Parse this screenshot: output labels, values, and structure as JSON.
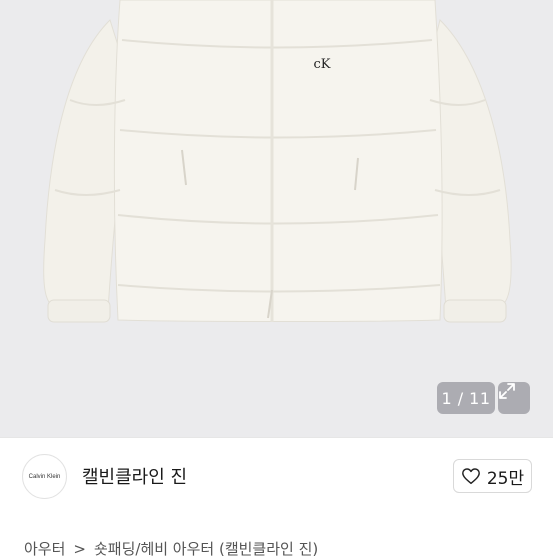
{
  "gallery": {
    "logo_text": "cK",
    "counter": "1 / 11",
    "expand_icon": "expand-icon"
  },
  "seller": {
    "avatar_text": "Calvin Klein",
    "name": "캘빈클라인 진",
    "like_icon": "heart-outline-icon",
    "like_count": "25만"
  },
  "breadcrumb": {
    "items": [
      "아우터",
      "숏패딩/헤비 아우터 (캘빈클라인 진)"
    ],
    "separator": ">"
  }
}
